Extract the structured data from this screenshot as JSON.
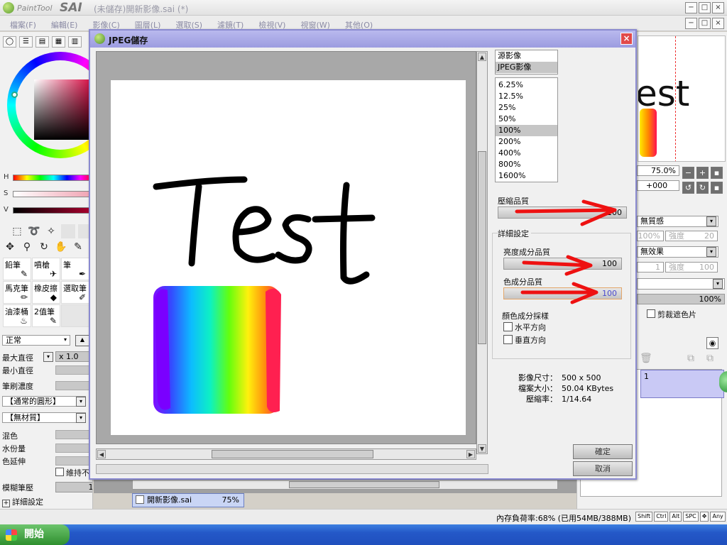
{
  "app": {
    "logo_small": "PaintTool",
    "logo_big": "SAI",
    "window_title": "(未儲存)開新影像.sai (*)",
    "window_buttons": [
      "−",
      "□",
      "×"
    ]
  },
  "menu": {
    "items": [
      "檔案(F)",
      "編輯(E)",
      "影像(C)",
      "圖層(L)",
      "選取(S)",
      "濾鏡(T)",
      "檢視(V)",
      "視窗(W)",
      "其他(O)"
    ]
  },
  "left_panel": {
    "slider_labels": [
      "H",
      "S",
      "V"
    ],
    "brushes": [
      {
        "label": "鉛筆",
        "icon": "pencil-icon"
      },
      {
        "label": "噴槍",
        "icon": "airbrush-icon"
      },
      {
        "label": "筆",
        "icon": "pen-icon"
      },
      {
        "label": "馬克筆",
        "icon": "marker-icon"
      },
      {
        "label": "橡皮擦",
        "icon": "eraser-icon"
      },
      {
        "label": "選取筆",
        "icon": "select-pen-icon"
      },
      {
        "label": "油漆桶",
        "icon": "bucket-icon"
      },
      {
        "label": "2值筆",
        "icon": "binary-pen-icon"
      }
    ],
    "blend_mode": "正常",
    "max_diameter_label": "最大直徑",
    "max_diameter_value": "x 1.0",
    "min_diameter_label": "最小直徑",
    "density_label": "筆刷濃度",
    "shape_value": "【通常的圓形】",
    "texture_value": "【無材質】",
    "blend_label": "混色",
    "water_label": "水份量",
    "color_extend_label": "色延伸",
    "keep_opacity_label": "維持不",
    "blur_pressure_label": "模糊筆壓",
    "blur_pressure_value": "100%",
    "detail_settings_label": "詳細設定"
  },
  "right_panel": {
    "preview_text": "est",
    "zoom_value": "75.0%",
    "angle_value": "+000",
    "texture_select": "無質感",
    "texture_pct": "100%",
    "texture_strength_label": "強度",
    "texture_strength_value": "20",
    "effect_select": "無效果",
    "effect_value": "1",
    "effect_strength_label": "強度",
    "effect_strength_value": "100",
    "opacity_value": "100%",
    "clip_label": "剪裁遮色片",
    "layer_number": "1"
  },
  "canvas": {
    "doc_tab_name": "開新影像.sai",
    "doc_tab_zoom": "75%"
  },
  "status": {
    "memory": "內存負荷率:68% (已用54MB/388MB)",
    "keys": [
      "Shift",
      "Ctrl",
      "Alt",
      "SPC",
      "Any"
    ]
  },
  "taskbar": {
    "start_label": "開始"
  },
  "dialog": {
    "title": "JPEG儲存",
    "close": "×",
    "preview_text": "Test",
    "source_options": [
      "源影像",
      "JPEG影像"
    ],
    "source_selected": 1,
    "zoom_options": [
      "6.25%",
      "12.5%",
      "25%",
      "50%",
      "100%",
      "200%",
      "400%",
      "800%",
      "1600%"
    ],
    "zoom_selected": 4,
    "compression_quality_label": "壓縮品質",
    "compression_quality_value": "100",
    "detail_settings_label": "詳細設定",
    "luma_quality_label": "亮度成分品質",
    "luma_quality_value": "100",
    "chroma_quality_label": "色成分品質",
    "chroma_quality_value": "100",
    "chroma_sampling_label": "顏色成分採樣",
    "horizontal_label": "水平方向",
    "vertical_label": "垂直方向",
    "horizontal_checked": false,
    "vertical_checked": false,
    "image_size_label": "影像尺寸：",
    "image_size_value": "500 x 500",
    "file_size_label": "檔案大小：",
    "file_size_value": "50.04 KBytes",
    "compression_ratio_label": "壓縮率：",
    "compression_ratio_value": "1/14.64",
    "ok_label": "確定",
    "cancel_label": "取消"
  },
  "colors": {
    "dialog_title_bg": "#a9a9e8",
    "accent_arrow": "#ee1111",
    "close_button": "#e14a4a",
    "selected_layer": "#c9c9f5"
  }
}
